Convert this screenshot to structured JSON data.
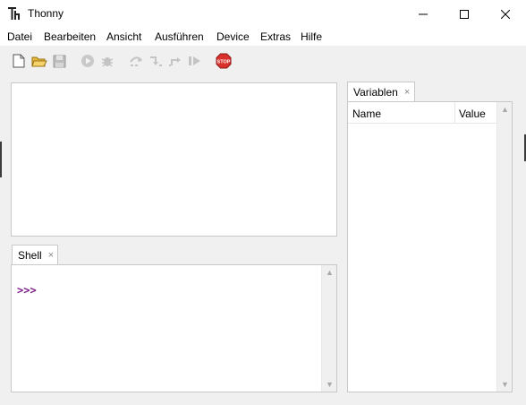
{
  "window": {
    "title": "Thonny"
  },
  "menu": {
    "items": [
      {
        "label": "Datei"
      },
      {
        "label": "Bearbeiten"
      },
      {
        "label": "Ansicht"
      },
      {
        "label": "Ausführen"
      },
      {
        "label": "Device"
      },
      {
        "label": "Extras"
      },
      {
        "label": "Hilfe"
      }
    ]
  },
  "toolbar": {
    "icons": [
      "new-file-icon",
      "open-folder-icon",
      "save-icon",
      "run-icon",
      "debug-icon",
      "step-over-icon",
      "step-into-icon",
      "step-out-icon",
      "resume-icon",
      "stop-icon"
    ],
    "stop_label": "STOP"
  },
  "shell": {
    "tab_label": "Shell",
    "tab_close": "×",
    "prompt": ">>>"
  },
  "variables": {
    "tab_label": "Variablen",
    "tab_close": "×",
    "columns": [
      "Name",
      "Value"
    ]
  },
  "colors": {
    "prompt": "#7a1c86",
    "stop": "#d9302c",
    "accent_green": "#3aa33a"
  }
}
